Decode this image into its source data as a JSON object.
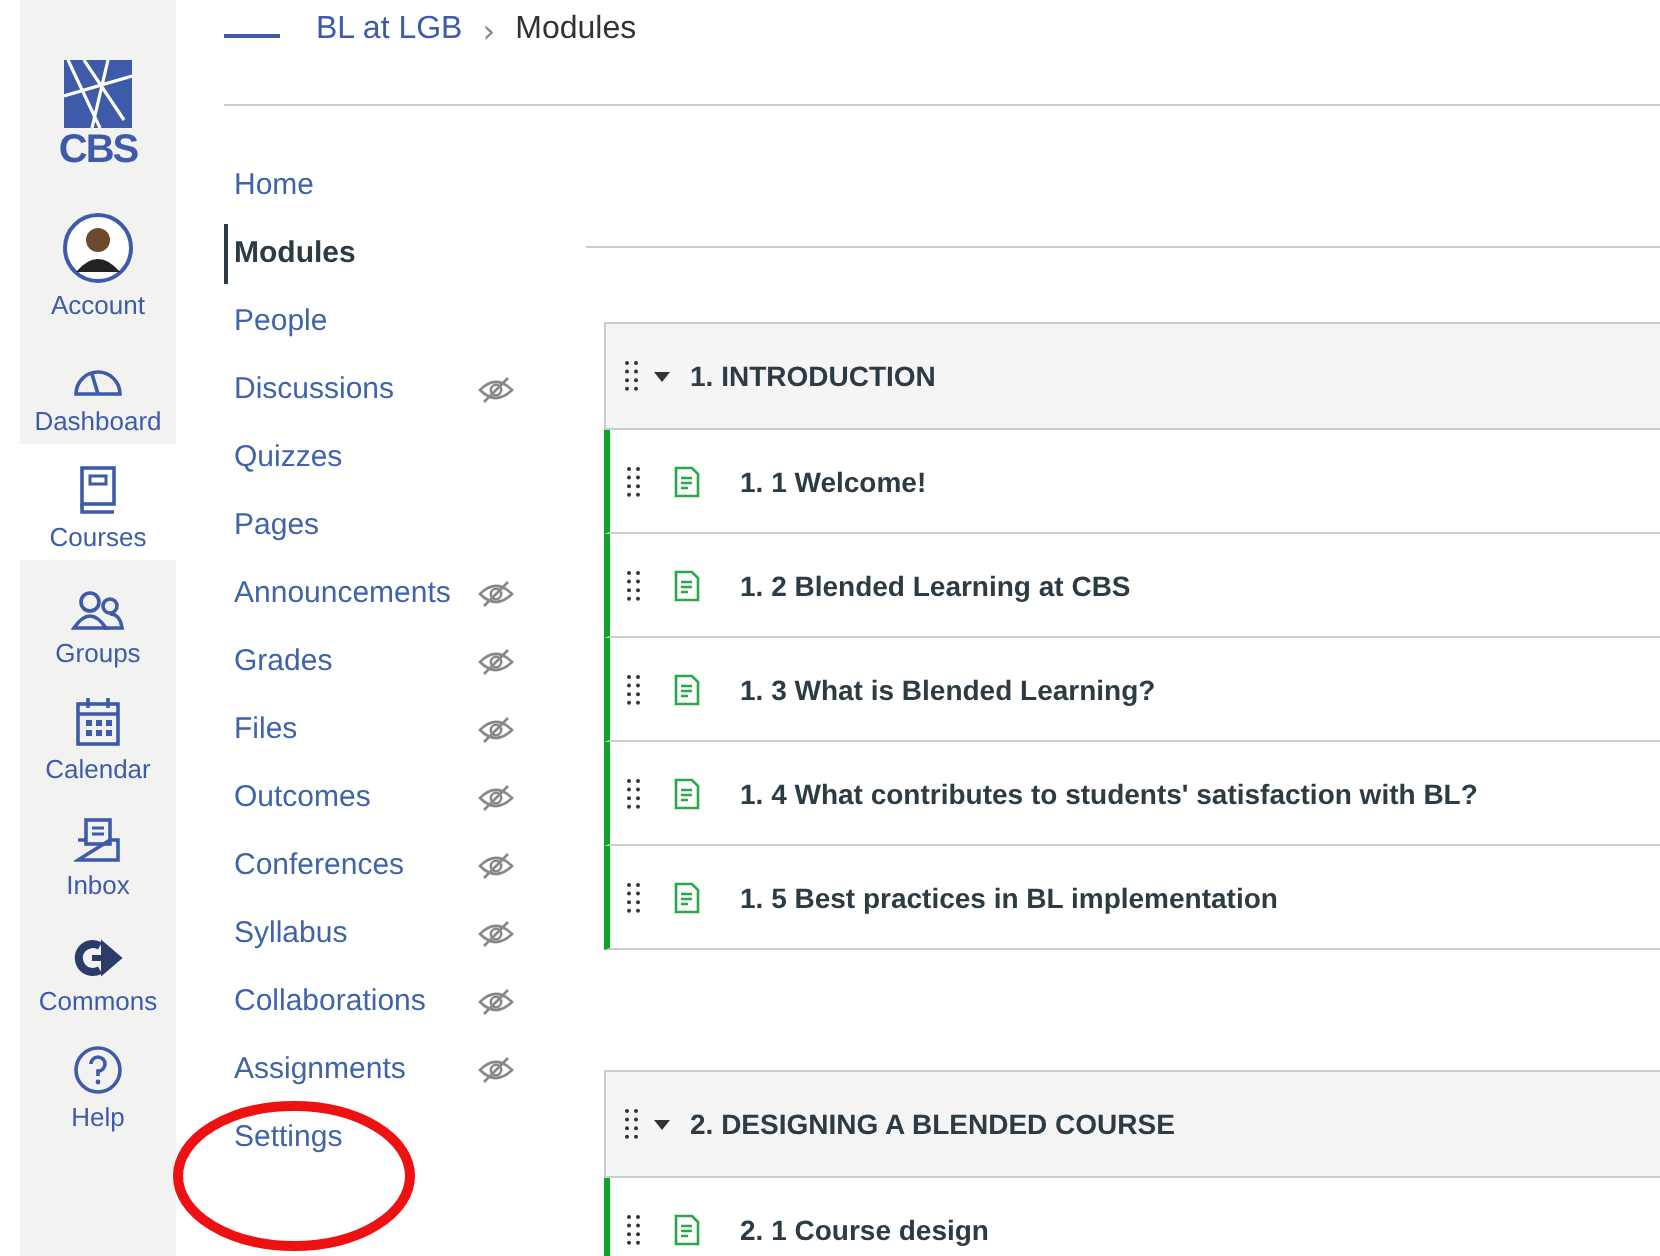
{
  "logo": {
    "text": "CBS"
  },
  "global_nav": [
    {
      "label": "Account",
      "kind": "avatar",
      "selected": false
    },
    {
      "label": "Dashboard",
      "kind": "dashboard",
      "selected": false
    },
    {
      "label": "Courses",
      "kind": "courses",
      "selected": true
    },
    {
      "label": "Groups",
      "kind": "groups",
      "selected": false
    },
    {
      "label": "Calendar",
      "kind": "calendar",
      "selected": false
    },
    {
      "label": "Inbox",
      "kind": "inbox",
      "selected": false
    },
    {
      "label": "Commons",
      "kind": "commons",
      "selected": false
    },
    {
      "label": "Help",
      "kind": "help",
      "selected": false
    }
  ],
  "breadcrumb": [
    "BL at LGB",
    "Modules"
  ],
  "breadcrumb_separator": "›",
  "course_nav": [
    {
      "label": "Home",
      "selected": false,
      "hidden": false
    },
    {
      "label": "Modules",
      "selected": true,
      "hidden": false
    },
    {
      "label": "People",
      "selected": false,
      "hidden": false
    },
    {
      "label": "Discussions",
      "selected": false,
      "hidden": true
    },
    {
      "label": "Quizzes",
      "selected": false,
      "hidden": false
    },
    {
      "label": "Pages",
      "selected": false,
      "hidden": false
    },
    {
      "label": "Announcements",
      "selected": false,
      "hidden": true
    },
    {
      "label": "Grades",
      "selected": false,
      "hidden": true
    },
    {
      "label": "Files",
      "selected": false,
      "hidden": true
    },
    {
      "label": "Outcomes",
      "selected": false,
      "hidden": true
    },
    {
      "label": "Conferences",
      "selected": false,
      "hidden": true
    },
    {
      "label": "Syllabus",
      "selected": false,
      "hidden": true
    },
    {
      "label": "Collaborations",
      "selected": false,
      "hidden": true
    },
    {
      "label": "Assignments",
      "selected": false,
      "hidden": true
    },
    {
      "label": "Settings",
      "selected": false,
      "hidden": false
    }
  ],
  "modules": [
    {
      "title": "1. INTRODUCTION",
      "expanded": true,
      "items": [
        {
          "title": "1. 1 Welcome!",
          "kind": "page"
        },
        {
          "title": "1. 2 Blended Learning at CBS",
          "kind": "page"
        },
        {
          "title": "1. 3 What is Blended Learning?",
          "kind": "page"
        },
        {
          "title": "1. 4 What contributes to students' satisfaction with BL?",
          "kind": "page"
        },
        {
          "title": "1. 5 Best practices in BL implementation",
          "kind": "page"
        }
      ]
    },
    {
      "title": "2. DESIGNING A BLENDED COURSE",
      "expanded": true,
      "items": [
        {
          "title": "2. 1 Course design",
          "kind": "page"
        }
      ]
    }
  ]
}
